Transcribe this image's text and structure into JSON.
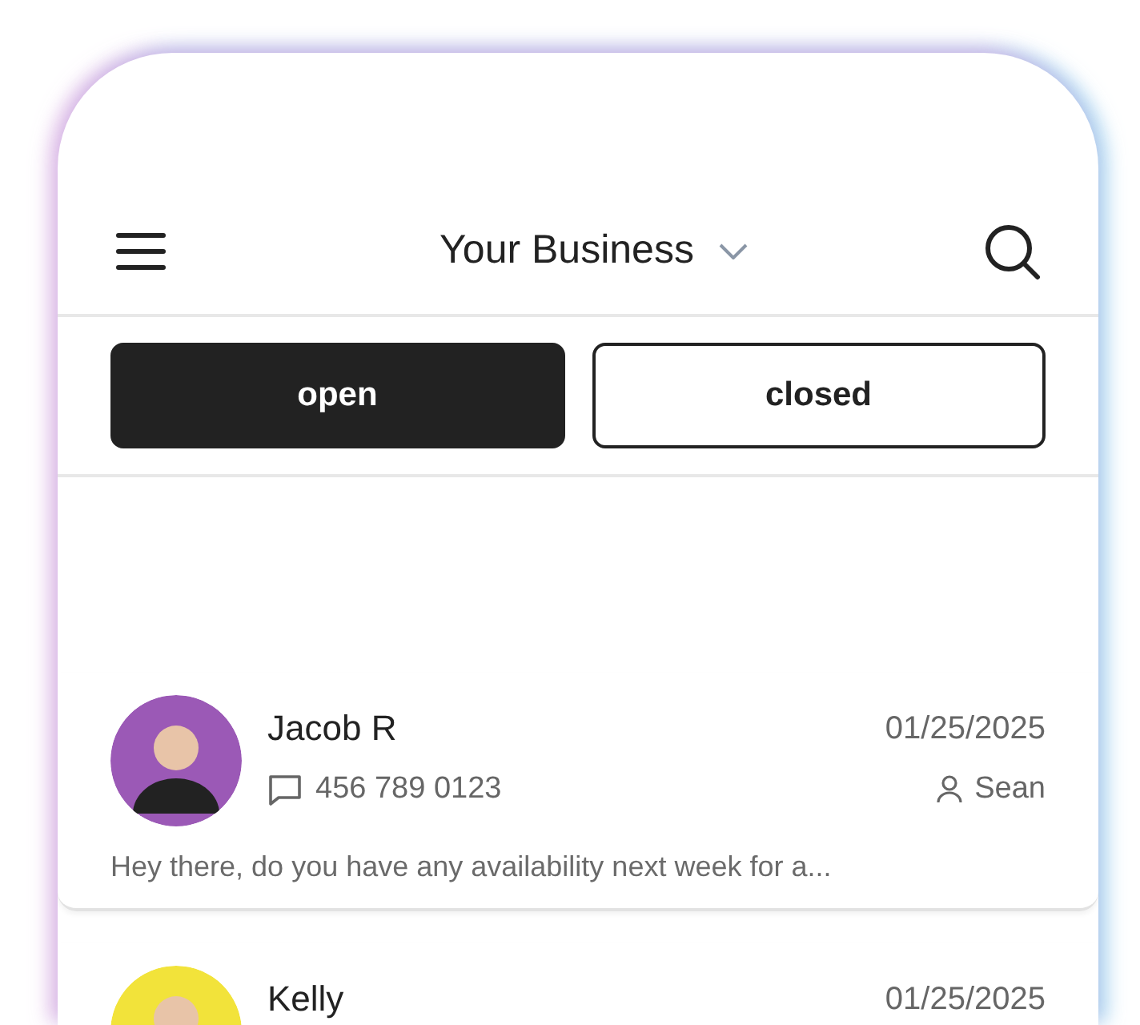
{
  "header": {
    "title": "Your Business"
  },
  "tabs": [
    {
      "label": "open",
      "selected": true
    },
    {
      "label": "closed",
      "selected": false
    }
  ],
  "conversations": [
    {
      "name": "Jacob R",
      "date": "01/25/2025",
      "phone": "456 789 0123",
      "assignee": "Sean",
      "preview": "Hey there, do you have any availability next week for a...",
      "color": "#9b59b6"
    },
    {
      "name": "Kelly",
      "date": "01/25/2025",
      "color": "#f2e33a"
    }
  ]
}
